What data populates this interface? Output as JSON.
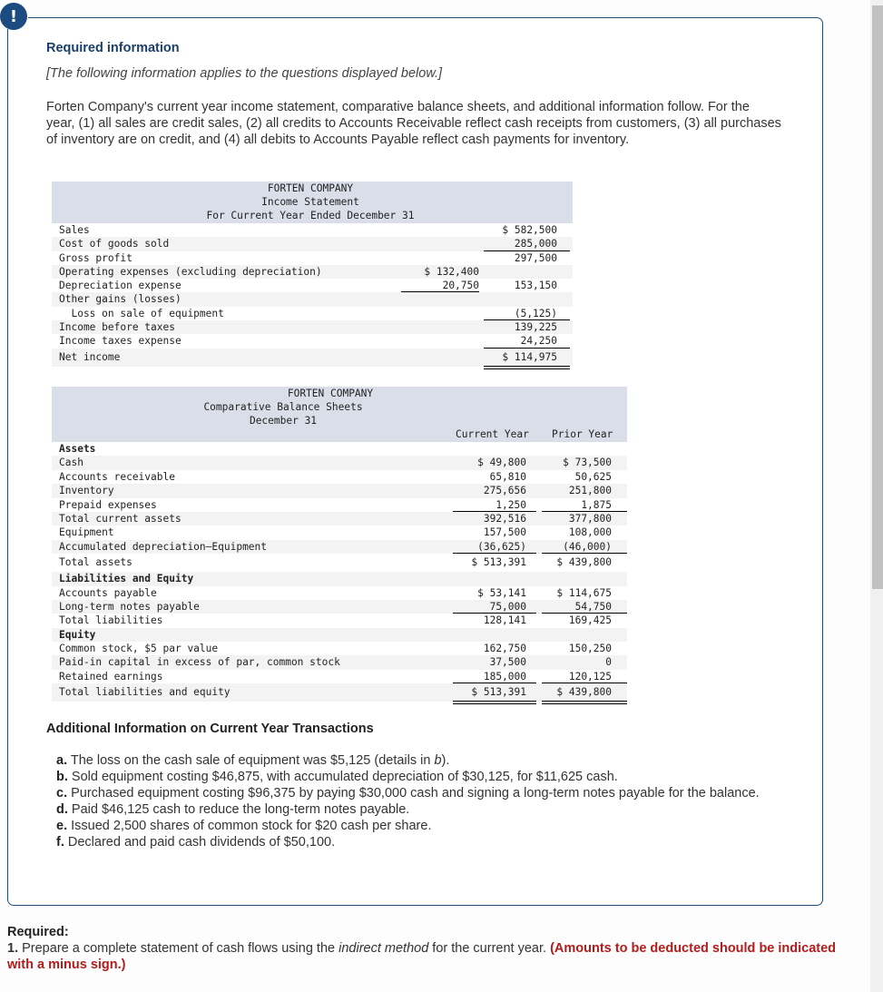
{
  "alert_icon": "exclamation-icon",
  "header": {
    "title": "Required information",
    "subtitle": "[The following information applies to the questions displayed below.]",
    "intro": "Forten Company's current year income statement, comparative balance sheets, and additional information follow. For the year, (1) all sales are credit sales, (2) all credits to Accounts Receivable reflect cash receipts from customers, (3) all purchases of inventory are on credit, and (4) all debits to Accounts Payable reflect cash payments for inventory."
  },
  "income_statement": {
    "company": "FORTEN COMPANY",
    "title": "Income Statement",
    "period": "For Current Year Ended December 31",
    "rows": [
      {
        "label": "Sales",
        "col1": "",
        "col2": "$ 582,500"
      },
      {
        "label": "Cost of goods sold",
        "col1": "",
        "col2": "285,000"
      },
      {
        "label": "Gross profit",
        "col1": "",
        "col2": "297,500"
      },
      {
        "label": "Operating expenses (excluding depreciation)",
        "col1": "$ 132,400",
        "col2": ""
      },
      {
        "label": "Depreciation expense",
        "col1": "20,750",
        "col2": "153,150"
      },
      {
        "label": "Other gains (losses)",
        "col1": "",
        "col2": ""
      },
      {
        "label": "  Loss on sale of equipment",
        "col1": "",
        "col2": "(5,125)"
      },
      {
        "label": "Income before taxes",
        "col1": "",
        "col2": "139,225"
      },
      {
        "label": "Income taxes expense",
        "col1": "",
        "col2": "24,250"
      },
      {
        "label": "Net income",
        "col1": "",
        "col2": "$ 114,975"
      }
    ]
  },
  "balance_sheet": {
    "company": "FORTEN COMPANY",
    "title": "Comparative Balance Sheets",
    "date": "December 31",
    "col_current": "Current Year",
    "col_prior": "Prior Year",
    "rows": [
      {
        "label": "Assets",
        "bold": true,
        "cy": "",
        "py": ""
      },
      {
        "label": "Cash",
        "cy": "$ 49,800",
        "py": "$ 73,500"
      },
      {
        "label": "Accounts receivable",
        "cy": "65,810",
        "py": "50,625"
      },
      {
        "label": "Inventory",
        "cy": "275,656",
        "py": "251,800"
      },
      {
        "label": "Prepaid expenses",
        "cy": "1,250",
        "py": "1,875"
      },
      {
        "label": "Total current assets",
        "cy": "392,516",
        "py": "377,800"
      },
      {
        "label": "Equipment",
        "cy": "157,500",
        "py": "108,000"
      },
      {
        "label": "Accumulated depreciation—Equipment",
        "cy": "(36,625)",
        "py": "(46,000)"
      },
      {
        "label": "Total assets",
        "cy": "$ 513,391",
        "py": "$ 439,800"
      },
      {
        "label": "Liabilities and Equity",
        "bold": true,
        "cy": "",
        "py": ""
      },
      {
        "label": "Accounts payable",
        "cy": "$ 53,141",
        "py": "$ 114,675"
      },
      {
        "label": "Long-term notes payable",
        "cy": "75,000",
        "py": "54,750"
      },
      {
        "label": "Total liabilities",
        "cy": "128,141",
        "py": "169,425"
      },
      {
        "label": "Equity",
        "bold": true,
        "cy": "",
        "py": ""
      },
      {
        "label": "Common stock, $5 par value",
        "cy": "162,750",
        "py": "150,250"
      },
      {
        "label": "Paid-in capital in excess of par, common stock",
        "cy": "37,500",
        "py": "0"
      },
      {
        "label": "Retained earnings",
        "cy": "185,000",
        "py": "120,125"
      },
      {
        "label": "Total liabilities and equity",
        "cy": "$ 513,391",
        "py": "$ 439,800"
      }
    ]
  },
  "additional_info": {
    "title": "Additional Information on Current Year Transactions",
    "items": [
      {
        "key": "a.",
        "text": " The loss on the cash sale of equipment was $5,125 (details in ",
        "em": "b",
        "tail": ")."
      },
      {
        "key": "b.",
        "text": " Sold equipment costing $46,875, with accumulated depreciation of $30,125, for $11,625 cash.",
        "em": "",
        "tail": ""
      },
      {
        "key": "c.",
        "text": " Purchased equipment costing $96,375 by paying $30,000 cash and signing a long-term notes payable for the balance.",
        "em": "",
        "tail": ""
      },
      {
        "key": "d.",
        "text": " Paid $46,125 cash to reduce the long-term notes payable.",
        "em": "",
        "tail": ""
      },
      {
        "key": "e.",
        "text": " Issued 2,500 shares of common stock for $20 cash per share.",
        "em": "",
        "tail": ""
      },
      {
        "key": "f.",
        "text": " Declared and paid cash dividends of $50,100.",
        "em": "",
        "tail": ""
      }
    ]
  },
  "required": {
    "heading": "Required:",
    "number": "1.",
    "text_before": " Prepare a complete statement of cash flows using the ",
    "text_italic": "indirect method",
    "text_after": " for the current year. ",
    "note": "(Amounts to be deducted should be indicated with a minus sign.)"
  }
}
